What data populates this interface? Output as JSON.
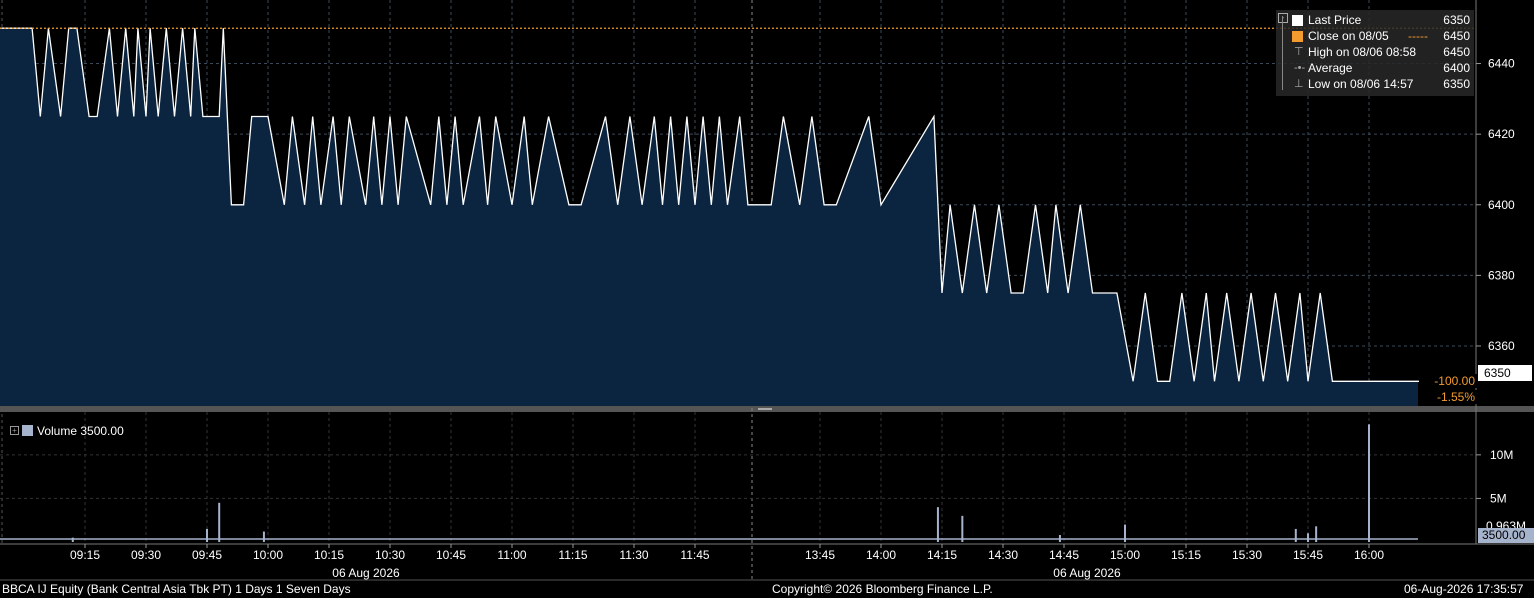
{
  "chart_data": [
    {
      "type": "area",
      "series": [
        {
          "name": "Last Price",
          "x": [
            "09:00",
            "09:02",
            "09:04",
            "09:06",
            "09:09",
            "09:11",
            "09:13",
            "09:16",
            "09:18",
            "09:21",
            "09:23",
            "09:25",
            "09:27",
            "09:28",
            "09:30",
            "09:31",
            "09:33",
            "09:35",
            "09:37",
            "09:39",
            "09:41",
            "09:42",
            "09:44",
            "09:48",
            "09:49",
            "09:51",
            "09:54",
            "09:56",
            "10:00",
            "10:04",
            "10:06",
            "10:09",
            "10:11",
            "10:13",
            "10:16",
            "10:18",
            "10:20",
            "10:24",
            "10:26",
            "10:28",
            "10:30",
            "10:32",
            "10:34",
            "10:40",
            "10:42",
            "10:44",
            "10:46",
            "10:48",
            "10:52",
            "10:54",
            "10:56",
            "11:00",
            "11:03",
            "11:05",
            "11:09",
            "11:14",
            "11:17",
            "11:23",
            "11:26",
            "11:29",
            "11:32",
            "11:35",
            "11:37",
            "11:39",
            "11:41",
            "11:43",
            "11:45",
            "11:47",
            "11:49",
            "11:51",
            "11:53",
            "11:56",
            "11:58",
            "13:33",
            "13:36",
            "13:40",
            "13:43",
            "13:46",
            "13:49",
            "13:57",
            "14:00",
            "14:13",
            "14:15",
            "14:17",
            "14:20",
            "14:23",
            "14:26",
            "14:29",
            "14:32",
            "14:35",
            "14:38",
            "14:41",
            "14:43",
            "14:46",
            "14:49",
            "14:52",
            "14:55",
            "14:58",
            "15:02",
            "15:05",
            "15:08",
            "15:11",
            "15:14",
            "15:17",
            "15:20",
            "15:22",
            "15:25",
            "15:28",
            "15:31",
            "15:34",
            "15:37",
            "15:40",
            "15:43",
            "15:45",
            "15:48",
            "15:51",
            "16:20"
          ],
          "y": [
            6450,
            6450,
            6425,
            6450,
            6425,
            6450,
            6450,
            6425,
            6425,
            6450,
            6425,
            6450,
            6425,
            6450,
            6425,
            6450,
            6425,
            6450,
            6425,
            6450,
            6425,
            6450,
            6425,
            6425,
            6450,
            6400,
            6400,
            6425,
            6425,
            6400,
            6425,
            6400,
            6425,
            6400,
            6425,
            6400,
            6425,
            6400,
            6425,
            6400,
            6425,
            6400,
            6425,
            6400,
            6425,
            6400,
            6425,
            6400,
            6425,
            6400,
            6425,
            6400,
            6425,
            6400,
            6425,
            6400,
            6400,
            6425,
            6400,
            6425,
            6400,
            6425,
            6400,
            6425,
            6400,
            6425,
            6400,
            6425,
            6400,
            6425,
            6400,
            6425,
            6400,
            6400,
            6425,
            6400,
            6425,
            6400,
            6400,
            6425,
            6400,
            6425,
            6375,
            6400,
            6375,
            6400,
            6375,
            6400,
            6375,
            6375,
            6400,
            6375,
            6400,
            6375,
            6400,
            6375,
            6375,
            6375,
            6350,
            6375,
            6350,
            6350,
            6375,
            6350,
            6375,
            6350,
            6375,
            6350,
            6375,
            6350,
            6375,
            6350,
            6375,
            6350,
            6375,
            6350,
            6350
          ]
        },
        {
          "name": "Close on 08/05",
          "value": 6450
        }
      ],
      "ylim": [
        6343,
        6458
      ],
      "yticks": [
        "6360",
        "6380",
        "6400",
        "6420",
        "6440"
      ],
      "xticks": [
        "09:15",
        "09:30",
        "09:45",
        "10:00",
        "10:15",
        "10:30",
        "10:45",
        "11:00",
        "11:15",
        "11:30",
        "11:45",
        "13:45",
        "14:00",
        "14:15",
        "14:30",
        "14:45",
        "15:00",
        "15:15",
        "15:30",
        "15:45",
        "16:00"
      ],
      "date_labels": [
        "06 Aug 2026",
        "06 Aug 2026"
      ],
      "grid": true
    },
    {
      "type": "bar",
      "series": [
        {
          "name": "Volume",
          "x": [
            "09:12",
            "09:45",
            "09:48",
            "09:59",
            "14:14",
            "14:20",
            "14:44",
            "15:00",
            "15:42",
            "15:45",
            "15:47",
            "16:00"
          ],
          "values": [
            0.5,
            1.5,
            4.5,
            1.2,
            4.0,
            3.0,
            0.8,
            2.0,
            1.5,
            1.0,
            1.8,
            13.5
          ]
        }
      ],
      "ylim": [
        0,
        14
      ],
      "yticks": [
        "5M",
        "10M"
      ],
      "tick_values": [
        5,
        10
      ],
      "grid": true
    }
  ],
  "legend": {
    "rows": [
      {
        "label": "Last Price",
        "value": "6350",
        "color": "#ffffff"
      },
      {
        "label": "Close on 08/05",
        "value": "6450",
        "color": "#f39b2e"
      },
      {
        "label": "High on 08/06 08:58",
        "value": "6450",
        "icon": "high-marker-icon"
      },
      {
        "label": "Average",
        "value": "6400",
        "icon": "average-marker-icon"
      },
      {
        "label": "Low on 08/06 14:57",
        "value": "6350",
        "icon": "low-marker-icon"
      }
    ]
  },
  "price_tag": "6350",
  "change": {
    "abs": "-100.00",
    "pct": "-1.55%"
  },
  "volume_legend": {
    "label": "Volume 3500.00"
  },
  "volume_tag": "3500.00",
  "volume_hidden_label": "0.963M",
  "footer": {
    "left": "BBCA IJ Equity (Bank Central Asia Tbk PT) 1 Days 1 Seven Days",
    "center": "Copyright© 2026 Bloomberg Finance L.P.",
    "right": "06-Aug-2026 17:35:57"
  },
  "colors": {
    "area": "#0b2540",
    "line": "#ffffff",
    "close": "#f39b2e",
    "volume": "#a6b3cc"
  }
}
